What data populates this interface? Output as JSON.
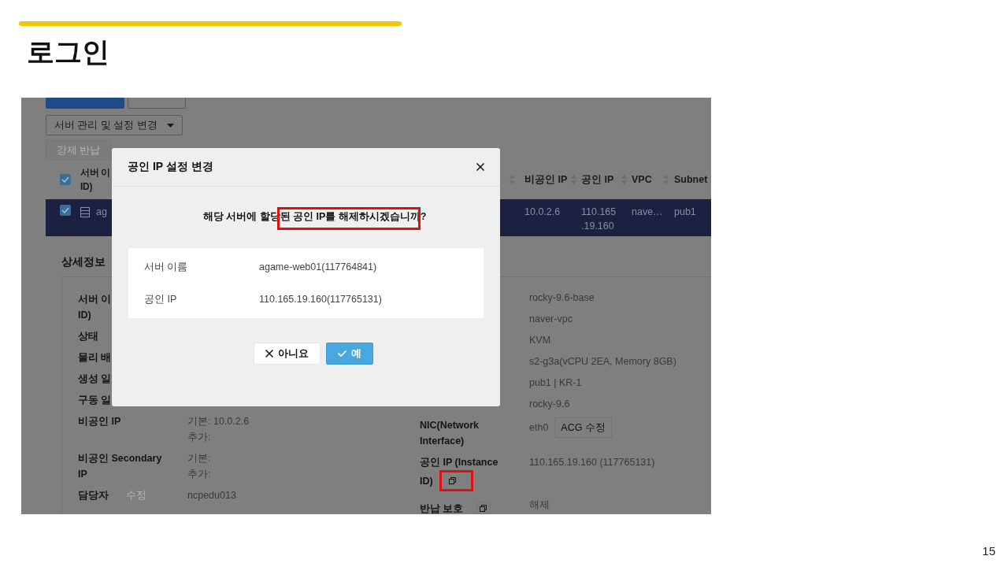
{
  "slide": {
    "title": "로그인",
    "page_number": "15"
  },
  "console": {
    "toolbar": {
      "dropdown": {
        "label": "서버 관리 및 설정 변경",
        "expanded": false
      },
      "force_return": {
        "label": "강제 반납",
        "disabled": true
      }
    },
    "table": {
      "header_checked": true,
      "name_header": [
        "서버 이",
        "ID)"
      ],
      "columns": [
        {
          "sortable": true
        },
        {
          "label": "비공인 IP",
          "sortable": true
        },
        {
          "label": "공인 IP",
          "sortable": true
        },
        {
          "label": "VPC",
          "sortable": true
        },
        {
          "label": "Subnet",
          "sortable": false
        }
      ],
      "rows": [
        {
          "selected": true,
          "checked": true,
          "name": "ag",
          "cells": [
            [],
            [
              "10.0.2.6"
            ],
            [
              "110.165",
              ".19.160"
            ],
            [
              "nave…"
            ],
            [
              "pub1"
            ]
          ]
        }
      ]
    },
    "details": {
      "title": "상세정보",
      "left": [
        {
          "label": [
            "서버 이",
            "ID)"
          ]
        },
        {
          "label": [
            "상태"
          ]
        },
        {
          "label": [
            "물리 배"
          ]
        },
        {
          "label": [
            "생성 일"
          ]
        },
        {
          "label": [
            "구동 일"
          ]
        },
        {
          "label": [
            "비공인 IP"
          ],
          "values": [
            "기본: 10.0.2.6",
            "추가:"
          ]
        },
        {
          "label": [
            "비공인 Secondary",
            "IP"
          ],
          "values": [
            "기본:",
            "추가:"
          ]
        },
        {
          "label": [
            "담당자"
          ],
          "edit": "수정",
          "values": [
            "ncpedu013"
          ]
        }
      ],
      "right": [
        {
          "values": [
            "rocky-9.6-base"
          ]
        },
        {
          "values": [
            "naver-vpc"
          ]
        },
        {
          "values": [
            "KVM"
          ]
        },
        {
          "values": [
            "s2-g3a(vCPU 2EA, Memory 8GB)"
          ]
        },
        {
          "values": [
            "pub1 | KR-1"
          ]
        },
        {
          "values": [
            "rocky-9.6"
          ]
        },
        {
          "label": [
            "NIC(Network",
            "Interface)"
          ],
          "values": [
            "eth0"
          ],
          "button": "ACG 수정"
        },
        {
          "label": [
            "공인 IP (Instance",
            "ID)"
          ],
          "copy": true,
          "highlighted": true,
          "values": [
            "110.165.19.160 (117765131)"
          ]
        },
        {
          "label": [
            "반납 보호"
          ],
          "copy": true,
          "highlighted": false,
          "values": [
            "해제"
          ]
        }
      ]
    }
  },
  "dialog": {
    "title": "공인 IP 설정 변경",
    "message": "해당 서버에 할당된 공인 IP를 해제하시겠습니까?",
    "message_highlighted": true,
    "info": [
      {
        "label": "서버 이름",
        "value": "agame-web01(117764841)"
      },
      {
        "label": "공인 IP",
        "value": "110.165.19.160(117765131)"
      }
    ],
    "buttons": [
      {
        "kind": "cancel",
        "label": "아니요"
      },
      {
        "kind": "confirm",
        "label": "예"
      }
    ]
  }
}
